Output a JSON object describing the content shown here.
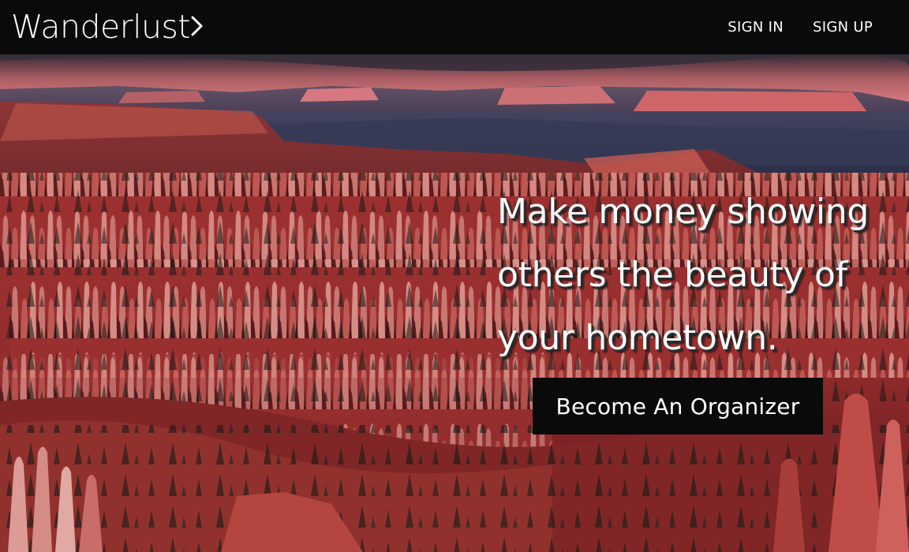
{
  "brand": {
    "name": "Wanderlust",
    "chevron_icon": "chevron-right-icon"
  },
  "nav": {
    "sign_in": "SIGN IN",
    "sign_up": "SIGN UP"
  },
  "hero": {
    "headline_line1": "Make money showing",
    "headline_line2": "others the beauty of",
    "headline_line3": "your hometown.",
    "cta_label": "Become An Organizer",
    "background_image": "red-canyon-hoodoos-landscape"
  },
  "colors": {
    "navbar_bg": "#0a0a0a",
    "text": "#ffffff",
    "cta_bg": "#0a0a0a",
    "rock_red": "#c63a36"
  }
}
